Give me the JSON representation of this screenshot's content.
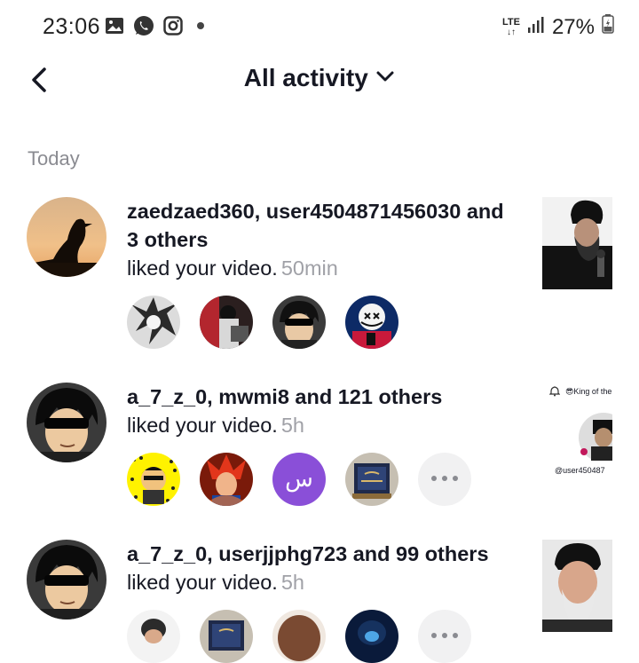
{
  "status_bar": {
    "time": "23:06",
    "network": "LTE",
    "battery": "27%",
    "icons": [
      "gallery-icon",
      "whatsapp-icon",
      "instagram-icon",
      "dot-icon",
      "signal-icon",
      "battery-icon"
    ]
  },
  "header": {
    "title": "All activity",
    "back_icon": "chevron-left-icon",
    "dropdown_icon": "chevron-down-icon"
  },
  "section": {
    "label": "Today"
  },
  "notifications": [
    {
      "names": "zaedzaed360, user4504871456030 and 3 others",
      "action": "liked your video.",
      "time": "50min"
    },
    {
      "names": "a_7_z_0, mwmi8 and 121 others",
      "action": "liked your video.",
      "time": "5h",
      "mini_label": "س",
      "thumb_caption": "😎King of the",
      "thumb_user": "@user450487"
    },
    {
      "names": "a_7_z_0, userjjphg723 and 99 others",
      "action": "liked your video.",
      "time": "5h"
    }
  ],
  "colors": {
    "text": "#161823",
    "muted": "#8a8b91",
    "timestamp": "#a0a1a7",
    "purple_avatar": "#8a4fd8"
  }
}
